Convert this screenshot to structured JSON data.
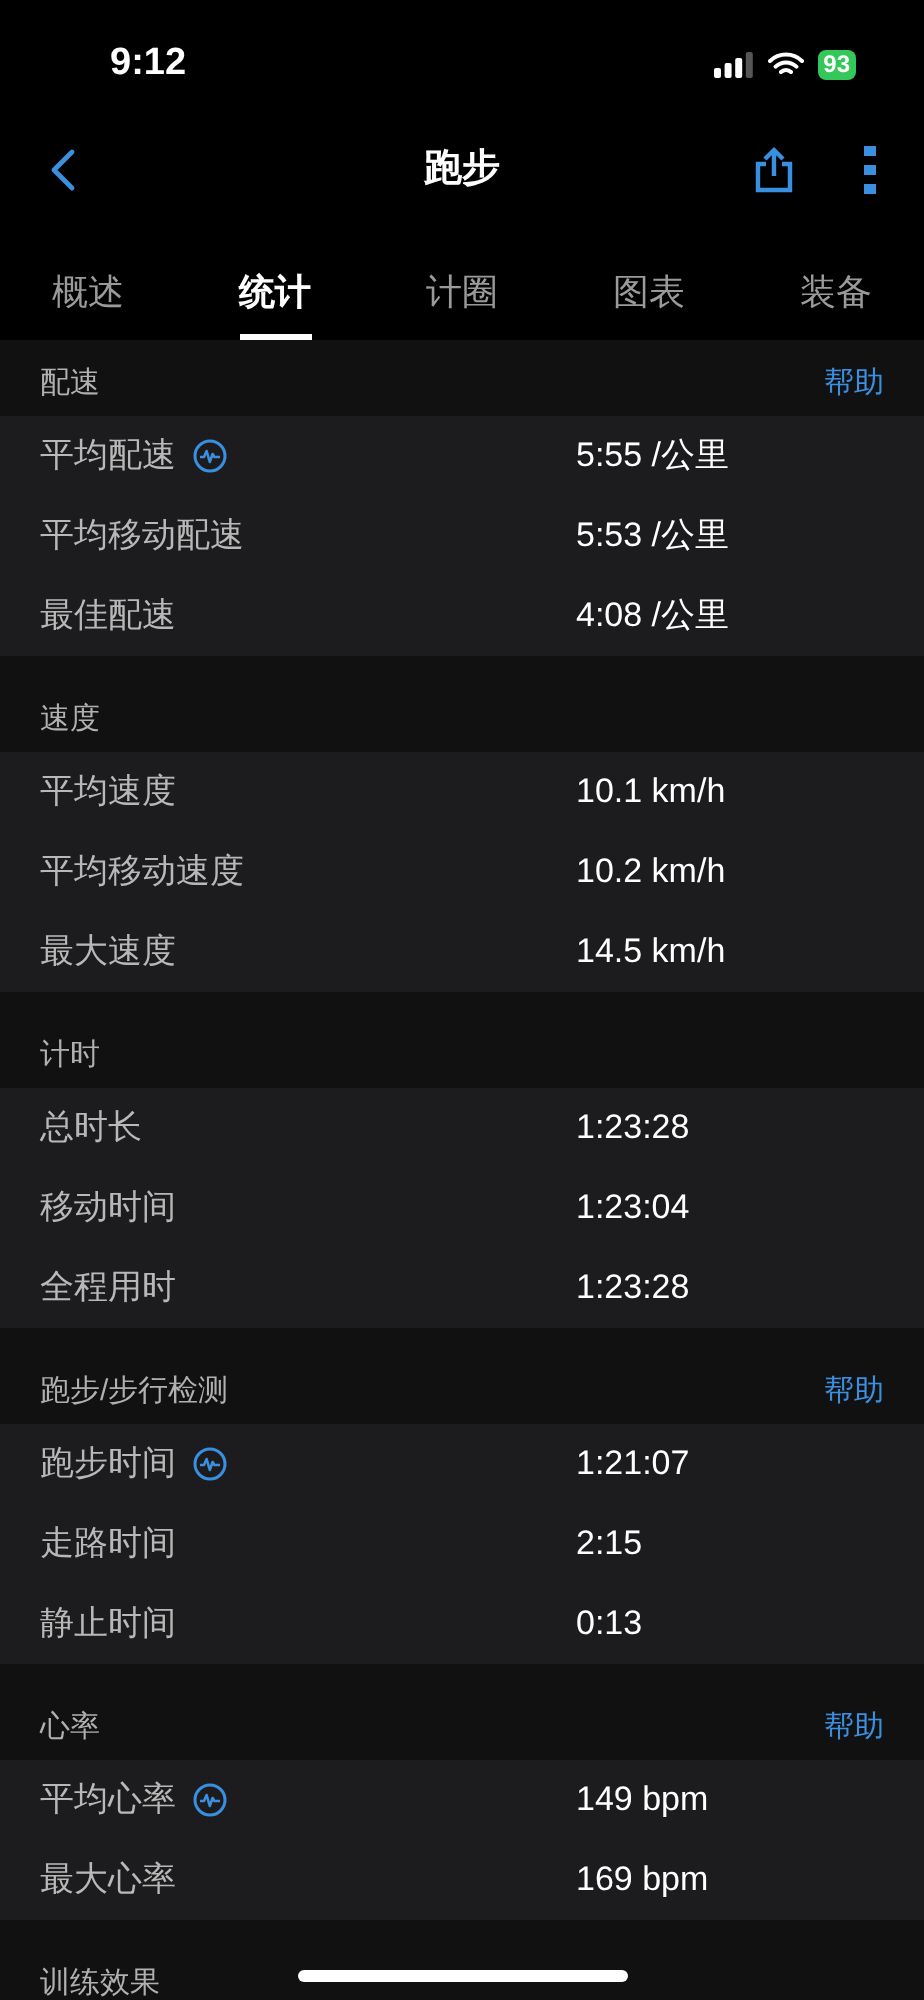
{
  "status_bar": {
    "time": "9:12",
    "battery": "93"
  },
  "nav": {
    "title": "跑步"
  },
  "tabs": [
    {
      "label": "概述",
      "selected": false
    },
    {
      "label": "统计",
      "selected": true
    },
    {
      "label": "计圈",
      "selected": false
    },
    {
      "label": "图表",
      "selected": false
    },
    {
      "label": "装备",
      "selected": false
    }
  ],
  "sections": [
    {
      "title": "配速",
      "help": "帮助",
      "rows": [
        {
          "label": "平均配速",
          "value": "5:55 /公里",
          "chart_link": true
        },
        {
          "label": "平均移动配速",
          "value": "5:53 /公里",
          "chart_link": false
        },
        {
          "label": "最佳配速",
          "value": "4:08 /公里",
          "chart_link": false
        }
      ]
    },
    {
      "title": "速度",
      "rows": [
        {
          "label": "平均速度",
          "value": "10.1 km/h",
          "chart_link": false
        },
        {
          "label": "平均移动速度",
          "value": "10.2 km/h",
          "chart_link": false
        },
        {
          "label": "最大速度",
          "value": "14.5 km/h",
          "chart_link": false
        }
      ]
    },
    {
      "title": "计时",
      "rows": [
        {
          "label": "总时长",
          "value": "1:23:28",
          "chart_link": false
        },
        {
          "label": "移动时间",
          "value": "1:23:04",
          "chart_link": false
        },
        {
          "label": "全程用时",
          "value": "1:23:28",
          "chart_link": false
        }
      ]
    },
    {
      "title": "跑步/步行检测",
      "help": "帮助",
      "rows": [
        {
          "label": "跑步时间",
          "value": "1:21:07",
          "chart_link": true
        },
        {
          "label": "走路时间",
          "value": "2:15",
          "chart_link": false
        },
        {
          "label": "静止时间",
          "value": "0:13",
          "chart_link": false
        }
      ]
    },
    {
      "title": "心率",
      "help": "帮助",
      "rows": [
        {
          "label": "平均心率",
          "value": "149 bpm",
          "chart_link": true
        },
        {
          "label": "最大心率",
          "value": "169 bpm",
          "chart_link": false
        }
      ]
    },
    {
      "title": "训练效果"
    }
  ]
}
